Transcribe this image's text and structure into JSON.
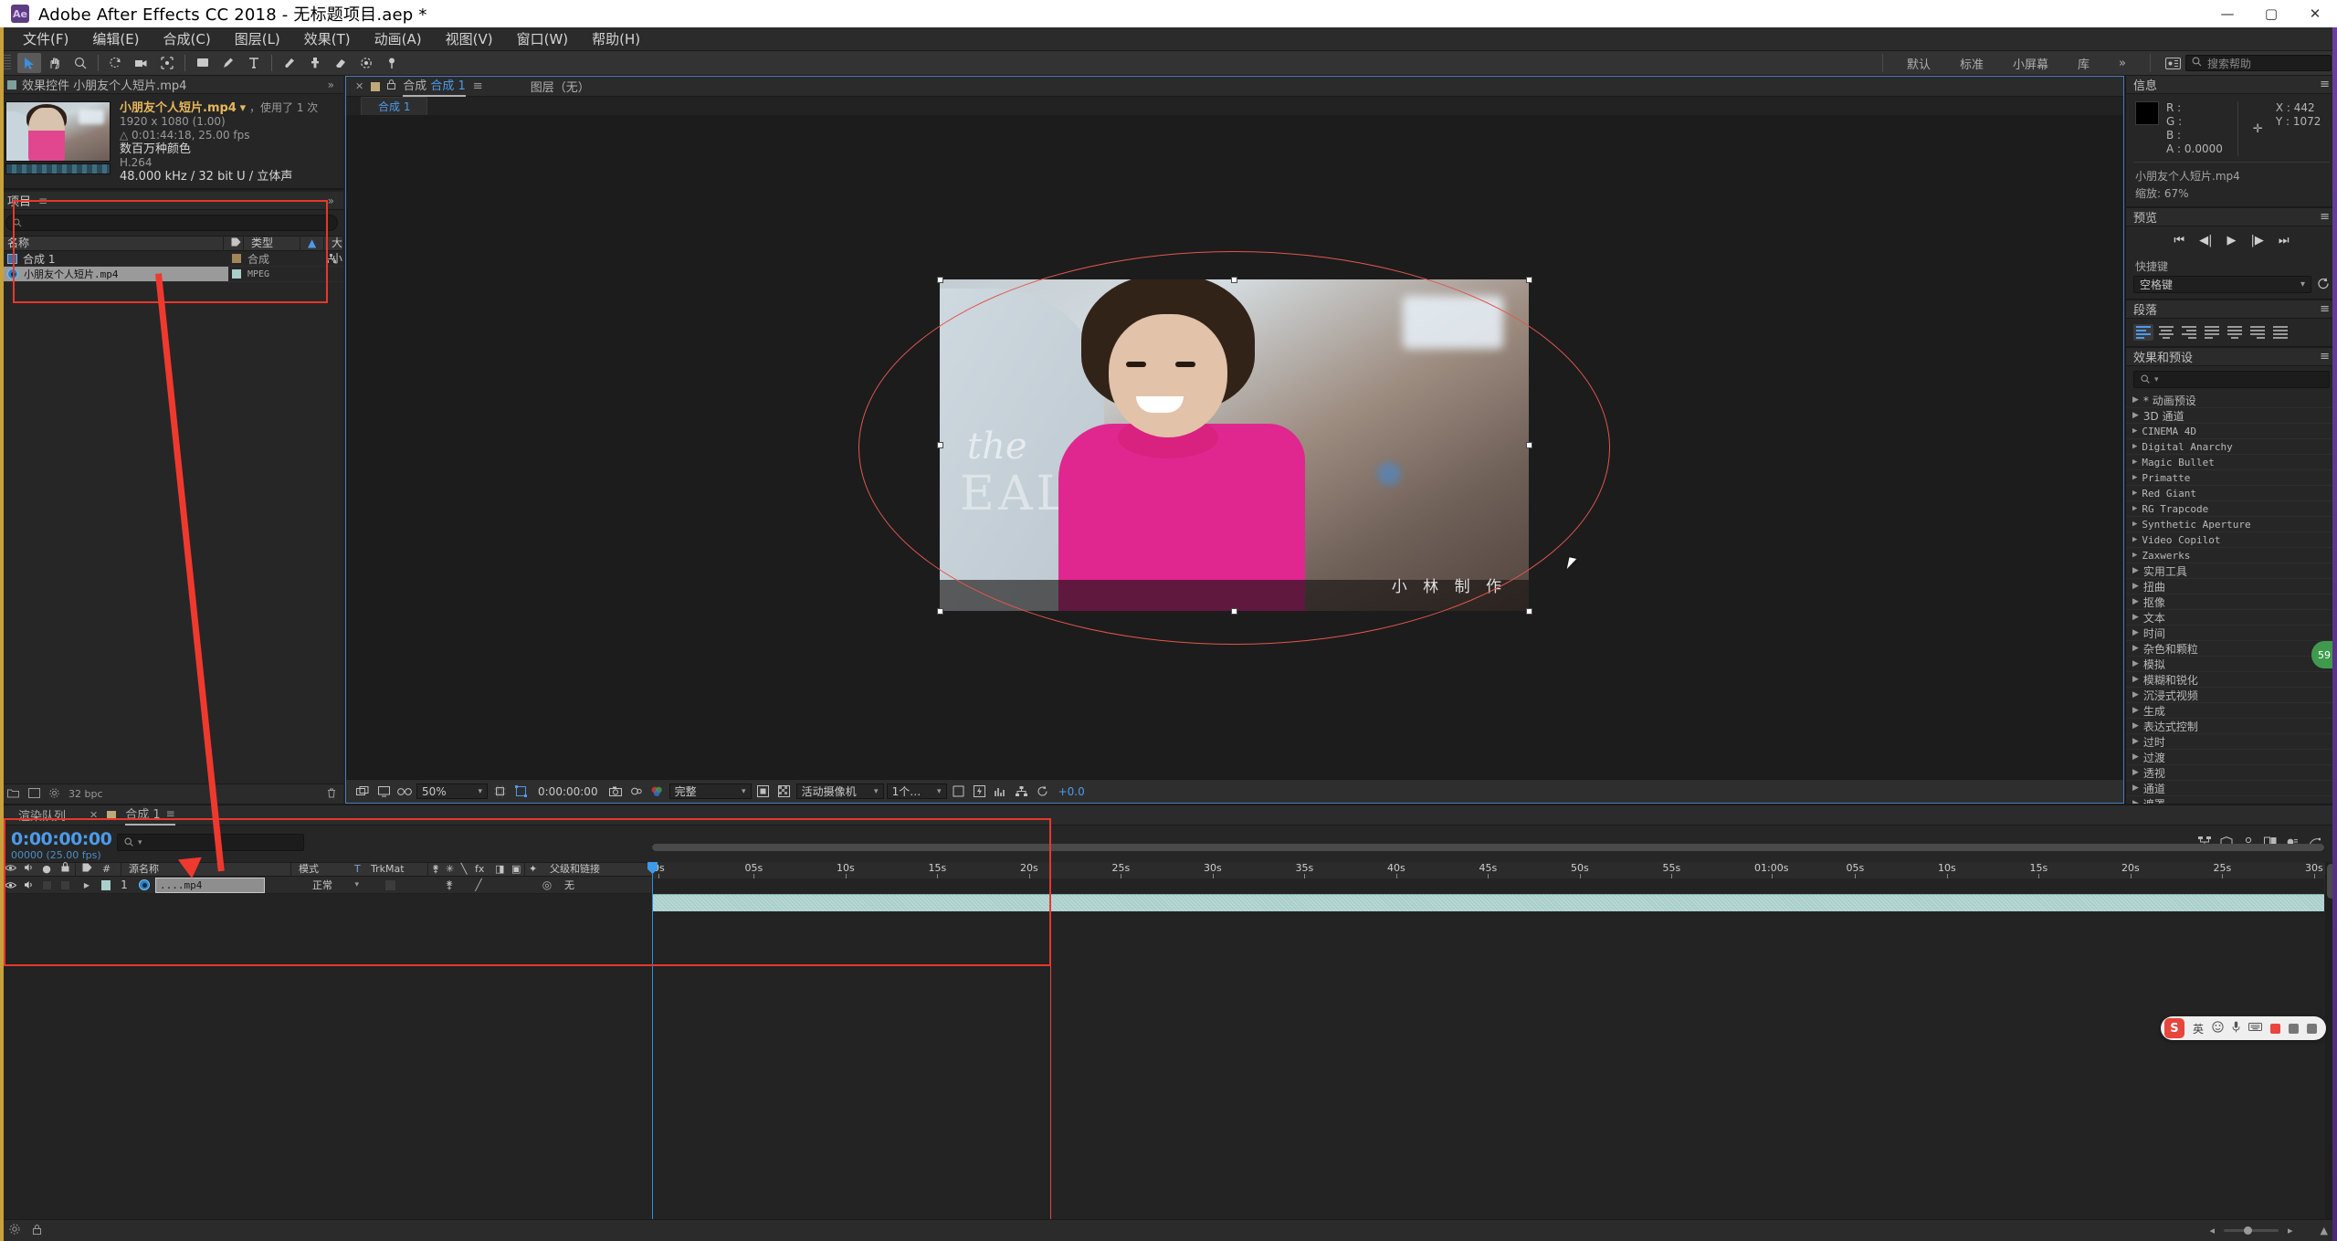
{
  "window": {
    "title": "Adobe After Effects CC 2018 - 无标题项目.aep *",
    "logo_text": "Ae",
    "minimize": "—",
    "maximize": "▢",
    "close": "✕"
  },
  "menus": [
    {
      "label": "文件(F)"
    },
    {
      "label": "编辑(E)"
    },
    {
      "label": "合成(C)"
    },
    {
      "label": "图层(L)"
    },
    {
      "label": "效果(T)"
    },
    {
      "label": "动画(A)"
    },
    {
      "label": "视图(V)"
    },
    {
      "label": "窗口(W)"
    },
    {
      "label": "帮助(H)"
    }
  ],
  "toolbar": {
    "tools": [
      {
        "name": "selection-tool",
        "glyph": "➤",
        "active": true
      },
      {
        "name": "hand-tool",
        "glyph": "✋",
        "active": false
      },
      {
        "name": "zoom-tool",
        "glyph": "🔍",
        "active": false
      },
      {
        "name": "rotation-tool",
        "glyph": "↻",
        "active": false
      },
      {
        "name": "camera-tool",
        "glyph": "🎥",
        "active": false
      },
      {
        "name": "pan-behind-tool",
        "glyph": "⛶",
        "active": false
      },
      {
        "name": "shape-tool",
        "glyph": "▭",
        "active": false
      },
      {
        "name": "pen-tool",
        "glyph": "✒",
        "active": false
      },
      {
        "name": "type-tool",
        "glyph": "T",
        "active": false
      },
      {
        "name": "brush-tool",
        "glyph": "🖌",
        "active": false
      },
      {
        "name": "clone-stamp-tool",
        "glyph": "⎘",
        "active": false
      },
      {
        "name": "eraser-tool",
        "glyph": "◧",
        "active": false
      },
      {
        "name": "roto-brush-tool",
        "glyph": "◐",
        "active": false
      },
      {
        "name": "puppet-pin-tool",
        "glyph": "✚",
        "active": false
      }
    ],
    "workspaces": [
      "默认",
      "标准",
      "小屏幕",
      "库"
    ],
    "overflow": "»",
    "help_placeholder": "搜索帮助",
    "help_icon": "search-icon"
  },
  "effect_controls": {
    "tab_label": "效果控件 小朋友个人短片.mp4",
    "file": {
      "name": "小朋友个人短片.mp4",
      "dropdown": "▾",
      "used": "，使用了 1 次",
      "resolution": "1920 x 1080 (1.00)",
      "duration": "△ 0:01:44:18, 25.00 fps",
      "colors": "数百万种颜色",
      "codec": "H.264",
      "audio": "48.000 kHz / 32 bit U / 立体声"
    }
  },
  "project": {
    "tab_label": "项目",
    "search_placeholder": "",
    "columns": [
      {
        "label": "名称",
        "name": "col-name"
      },
      {
        "label": "类型",
        "name": "col-type"
      },
      {
        "label": "大小",
        "name": "col-size"
      }
    ],
    "sort_arrow": "▲",
    "items": [
      {
        "name": "合成 1",
        "type": "合成",
        "icon": "composition-icon",
        "selected": false
      },
      {
        "name": "小朋友个人短片.mp4",
        "type": "MPEG",
        "icon": "footage-icon",
        "selected": true
      }
    ],
    "footer": {
      "bpc": "32 bpc"
    }
  },
  "composition_viewer": {
    "close_x": "✕",
    "lock_icon": "lock-icon",
    "label": "合成",
    "comp_name": "合成 1",
    "menu_icon": "≡",
    "layer_label": "图层（无）",
    "breadcrumb": "合成 1",
    "watermark": "小 林 制 作",
    "shirt_text1": "the",
    "shirt_text2": "EAL",
    "bottom_bar": {
      "magnification": "50%",
      "timecode": "0:00:00:00",
      "resolution": "完整",
      "camera": "活动摄像机",
      "views": "1个…",
      "exposure": "+0.0"
    }
  },
  "info_panel": {
    "title": "信息",
    "menu_icon": "≡",
    "R": "R :",
    "G": "G :",
    "B": "B :",
    "A": "A :",
    "a_value": "0.0000",
    "x_label": "X :",
    "x_value": "442",
    "y_label": "Y :",
    "y_value": "1072",
    "file_name": "小朋友个人短片.mp4",
    "zoom_label": "缩放:",
    "zoom_value": "67%"
  },
  "preview_panel": {
    "title": "预览",
    "menu_icon": "≡",
    "buttons": [
      "⏮",
      "◀|",
      "▶",
      "|▶",
      "⏭"
    ],
    "shortcut_label": "快捷键",
    "shortcut_value": "空格键",
    "reset_icon": "reset-icon"
  },
  "paragraph_panel": {
    "title": "段落",
    "menu_icon": "≡",
    "align_buttons": [
      "align-left",
      "align-center",
      "align-right",
      "justify-last-left",
      "justify-last-center",
      "justify-last-right",
      "justify-all"
    ]
  },
  "effects_presets": {
    "title": "效果和预设",
    "menu_icon": "≡",
    "search_placeholder": "",
    "items": [
      {
        "label": "* 动画预设",
        "mono": false
      },
      {
        "label": "3D 通道",
        "mono": false
      },
      {
        "label": "CINEMA 4D",
        "mono": true
      },
      {
        "label": "Digital Anarchy",
        "mono": true
      },
      {
        "label": "Magic Bullet",
        "mono": true
      },
      {
        "label": "Primatte",
        "mono": true
      },
      {
        "label": "Red Giant",
        "mono": true
      },
      {
        "label": "RG Trapcode",
        "mono": true
      },
      {
        "label": "Synthetic Aperture",
        "mono": true
      },
      {
        "label": "Video Copilot",
        "mono": true
      },
      {
        "label": "Zaxwerks",
        "mono": true
      },
      {
        "label": "实用工具",
        "mono": false
      },
      {
        "label": "扭曲",
        "mono": false
      },
      {
        "label": "抠像",
        "mono": false
      },
      {
        "label": "文本",
        "mono": false
      },
      {
        "label": "时间",
        "mono": false
      },
      {
        "label": "杂色和颗粒",
        "mono": false
      },
      {
        "label": "模拟",
        "mono": false
      },
      {
        "label": "模糊和锐化",
        "mono": false
      },
      {
        "label": "沉浸式视频",
        "mono": false
      },
      {
        "label": "生成",
        "mono": false
      },
      {
        "label": "表达式控制",
        "mono": false
      },
      {
        "label": "过时",
        "mono": false
      },
      {
        "label": "过渡",
        "mono": false
      },
      {
        "label": "透视",
        "mono": false
      },
      {
        "label": "通道",
        "mono": false
      },
      {
        "label": "遮罩",
        "mono": false
      }
    ]
  },
  "timeline": {
    "tabs": [
      {
        "label": "渲染队列",
        "active": false
      },
      {
        "label": "合成 1",
        "active": true
      }
    ],
    "close_x": "✕",
    "menu_icon": "≡",
    "current_time": "0:00:00:00",
    "frame_info": "00000 (25.00 fps)",
    "search_placeholder": "",
    "columns": [
      {
        "label": "#",
        "name": "col-index"
      },
      {
        "label": "源名称",
        "name": "col-source-name"
      },
      {
        "label": "模式",
        "name": "col-mode"
      },
      {
        "label": "T",
        "name": "col-t"
      },
      {
        "label": "TrkMat",
        "name": "col-trkmat"
      },
      {
        "label": "父级和链接",
        "name": "col-parent"
      }
    ],
    "layer": {
      "index": "1",
      "name": "....mp4",
      "mode": "正常",
      "parent": "无",
      "eye_icon": "eye-icon",
      "audio_icon": "speaker-icon"
    },
    "ruler_ticks": [
      "0s",
      "05s",
      "10s",
      "15s",
      "20s",
      "25s",
      "30s",
      "35s",
      "40s",
      "45s",
      "50s",
      "55s",
      "01:00s",
      "05s",
      "10s",
      "15s",
      "20s",
      "25s",
      "30s"
    ]
  },
  "statusbar": {
    "left_icons": [
      "gear-icon",
      "lock-icon"
    ],
    "zoom_minus": "◂",
    "zoom_plus": "▸",
    "expand": "▲"
  },
  "floating_toolbar": {
    "logo": "S",
    "label": "英",
    "icons": [
      "emoji-icon",
      "mic-icon",
      "keyboard-icon",
      "screenshot-icon",
      "more-icon"
    ]
  },
  "notification_badge": {
    "value": "59"
  },
  "colors": {
    "accent_blue": "#4c9bea",
    "annotation_red": "#e8372c",
    "layer_band": "#a9cfcc",
    "title_orange": "#e6b85c"
  }
}
